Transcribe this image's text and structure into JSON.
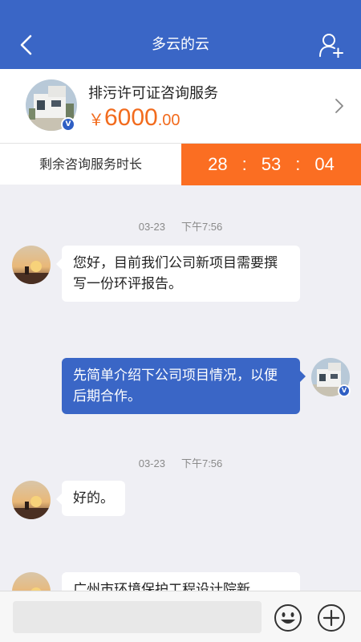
{
  "header": {
    "title": "多云的云",
    "back_icon": "back-arrow-icon",
    "action_icon": "add-user-icon"
  },
  "service": {
    "name": "排污许可证咨询服务",
    "price_currency": "￥",
    "price_integer": "6000",
    "price_decimal": ".00",
    "verified_mark": "V"
  },
  "timer": {
    "label": "剩余咨询服务时长",
    "hours": "28",
    "minutes": "53",
    "seconds": "04",
    "separator": ":"
  },
  "messages": [
    {
      "timestamp": {
        "date": "03-23",
        "time": "下午7:56"
      },
      "side": "left",
      "text": "您好，目前我们公司新项目需要撰写一份环评报告。"
    },
    {
      "side": "right",
      "text": "先简单介绍下公司项目情况，以便后期合作。"
    },
    {
      "timestamp": {
        "date": "03-23",
        "time": "下午7:56"
      },
      "side": "left",
      "text": "好的。"
    },
    {
      "side": "left",
      "text": "广州市环境保护工程设计院新"
    }
  ],
  "composer": {
    "input_value": "",
    "emoji_icon": "emoji-icon",
    "plus_icon": "plus-icon"
  },
  "colors": {
    "header_bg": "#3a66c6",
    "price": "#f26b1d",
    "timer_bg": "#fb6e22",
    "outgoing_bubble": "#3a66c6"
  }
}
